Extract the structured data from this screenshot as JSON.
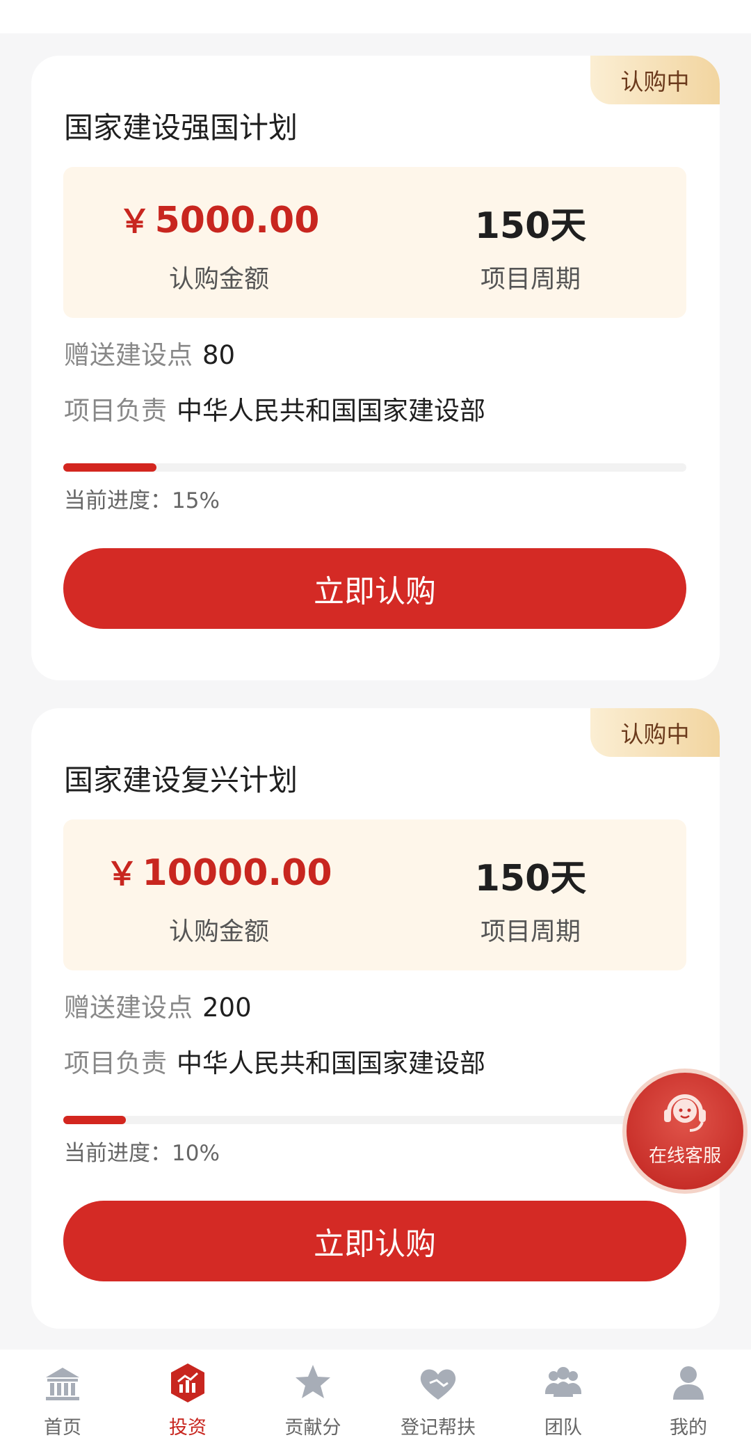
{
  "cards": [
    {
      "status": "认购中",
      "title": "国家建设强国计划",
      "currency": "￥",
      "amount": "5000.00",
      "amount_label": "认购金额",
      "period": "150天",
      "period_label": "项目周期",
      "gift_label": "赠送建设点",
      "gift_value": "80",
      "owner_label": "项目负责",
      "owner_value": "中华人民共和国国家建设部",
      "progress_text": "当前进度：15%",
      "progress": 15,
      "button": "立即认购"
    },
    {
      "status": "认购中",
      "title": "国家建设复兴计划",
      "currency": "￥",
      "amount": "10000.00",
      "amount_label": "认购金额",
      "period": "150天",
      "period_label": "项目周期",
      "gift_label": "赠送建设点",
      "gift_value": "200",
      "owner_label": "项目负责",
      "owner_value": "中华人民共和国国家建设部",
      "progress_text": "当前进度：10%",
      "progress": 10,
      "button": "立即认购"
    }
  ],
  "customer_service": {
    "label": "在线客服",
    "icon": "headset-agent-icon"
  },
  "nav": {
    "items": [
      {
        "label": "首页",
        "icon": "bank-building-icon",
        "active": false
      },
      {
        "label": "投资",
        "icon": "chart-hexagon-icon",
        "active": true
      },
      {
        "label": "贡献分",
        "icon": "star-icon",
        "active": false
      },
      {
        "label": "登记帮扶",
        "icon": "handshake-heart-icon",
        "active": false
      },
      {
        "label": "团队",
        "icon": "group-icon",
        "active": false
      },
      {
        "label": "我的",
        "icon": "user-icon",
        "active": false
      }
    ]
  },
  "colors": {
    "accent": "#d42a25",
    "tag_bg_start": "#fbeed3",
    "tag_bg_end": "#f2d5a0",
    "info_box_bg": "#fef6ea",
    "nav_inactive": "#9aa0aa"
  }
}
